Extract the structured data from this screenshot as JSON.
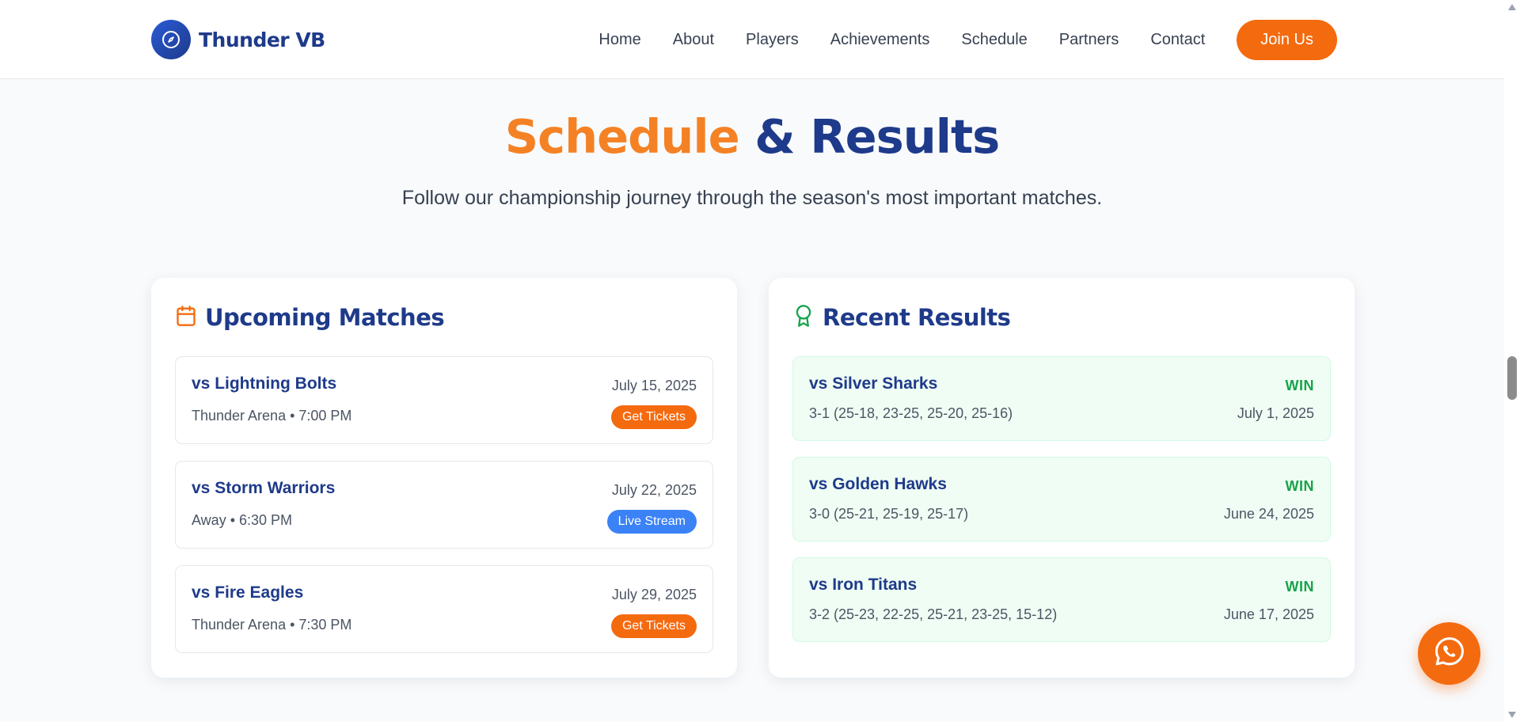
{
  "brand": {
    "name": "Thunder VB"
  },
  "nav": {
    "items": [
      "Home",
      "About",
      "Players",
      "Achievements",
      "Schedule",
      "Partners",
      "Contact"
    ],
    "cta": "Join Us"
  },
  "hero": {
    "title_part1": "Schedule",
    "title_part2": " & Results",
    "subtitle": "Follow our championship journey through the season's most important matches."
  },
  "upcoming": {
    "title": "Upcoming Matches",
    "matches": [
      {
        "opponent": "vs Lightning Bolts",
        "date": "July 15, 2025",
        "details": "Thunder Arena • 7:00 PM",
        "action": "Get Tickets",
        "action_color": "#f46a0f"
      },
      {
        "opponent": "vs Storm Warriors",
        "date": "July 22, 2025",
        "details": "Away • 6:30 PM",
        "action": "Live Stream",
        "action_color": "#3b82f6"
      },
      {
        "opponent": "vs Fire Eagles",
        "date": "July 29, 2025",
        "details": "Thunder Arena • 7:30 PM",
        "action": "Get Tickets",
        "action_color": "#f46a0f"
      }
    ]
  },
  "results": {
    "title": "Recent Results",
    "matches": [
      {
        "opponent": "vs Silver Sharks",
        "outcome": "WIN",
        "score": "3-1 (25-18, 23-25, 25-20, 25-16)",
        "date": "July 1, 2025"
      },
      {
        "opponent": "vs Golden Hawks",
        "outcome": "WIN",
        "score": "3-0 (25-21, 25-19, 25-17)",
        "date": "June 24, 2025"
      },
      {
        "opponent": "vs Iron Titans",
        "outcome": "WIN",
        "score": "3-2 (25-23, 22-25, 25-21, 23-25, 15-12)",
        "date": "June 17, 2025"
      }
    ]
  },
  "colors": {
    "navy": "#1e3a8a",
    "orange": "#f46a0f",
    "accent_orange": "#f48225",
    "win_green": "#16a34a",
    "blue": "#3b82f6"
  },
  "icons": {
    "logo": "compass-icon",
    "upcoming": "calendar-icon",
    "results": "award-icon",
    "fab": "whatsapp-icon"
  }
}
